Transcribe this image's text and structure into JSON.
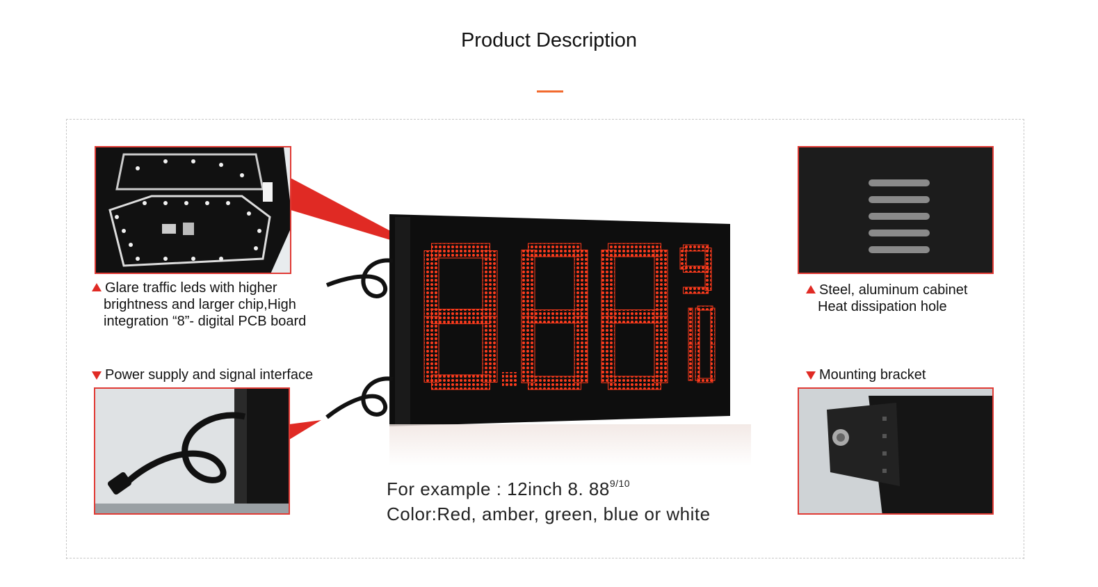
{
  "page": {
    "title": "Product Description",
    "accent_color": "#f26a2e",
    "callout_color": "#e02a24"
  },
  "callouts": {
    "pcb": {
      "lines": [
        "Glare traffic leds with higher",
        "brightness and larger chip,High",
        "integration “8”- digital PCB  board"
      ],
      "icon": "triangle-up-icon"
    },
    "power": {
      "lines": [
        "Power supply and signal interface"
      ],
      "icon": "triangle-down-icon"
    },
    "cabinet": {
      "lines": [
        "Steel, aluminum cabinet",
        "Heat dissipation hole"
      ],
      "icon": "triangle-up-icon"
    },
    "bracket": {
      "lines": [
        "Mounting bracket"
      ],
      "icon": "triangle-down-icon"
    }
  },
  "display": {
    "digits": "8.88",
    "fraction_top": "9",
    "fraction_bottom": "10",
    "led_color": "#ff3b1c"
  },
  "example": {
    "line1_prefix": "For example : 12inch  8. 88",
    "line1_sup": "9/10",
    "line2": "Color:Red, amber, green, blue or white"
  }
}
